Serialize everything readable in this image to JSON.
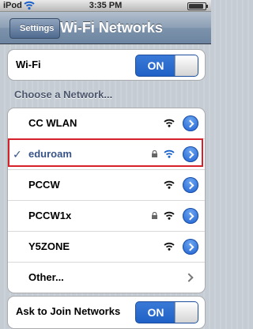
{
  "status_bar": {
    "carrier": "iPod",
    "time": "3:35 PM"
  },
  "nav": {
    "back_label": "Settings",
    "title": "Wi-Fi Networks"
  },
  "wifi_toggle": {
    "label": "Wi-Fi",
    "state": "ON"
  },
  "section_header": "Choose a Network...",
  "networks": [
    {
      "name": "CC WLAN",
      "locked": false,
      "selected": false
    },
    {
      "name": "eduroam",
      "locked": true,
      "selected": true,
      "check": "✓"
    },
    {
      "name": "PCCW",
      "locked": false,
      "selected": false
    },
    {
      "name": "PCCW1x",
      "locked": true,
      "selected": false
    },
    {
      "name": "Y5ZONE",
      "locked": false,
      "selected": false
    }
  ],
  "other_label": "Other...",
  "ask_to_join": {
    "label": "Ask to Join Networks",
    "state": "ON"
  },
  "colors": {
    "accent": "#1f61c7",
    "selected_text": "#385487",
    "highlight": "#d6202a"
  }
}
